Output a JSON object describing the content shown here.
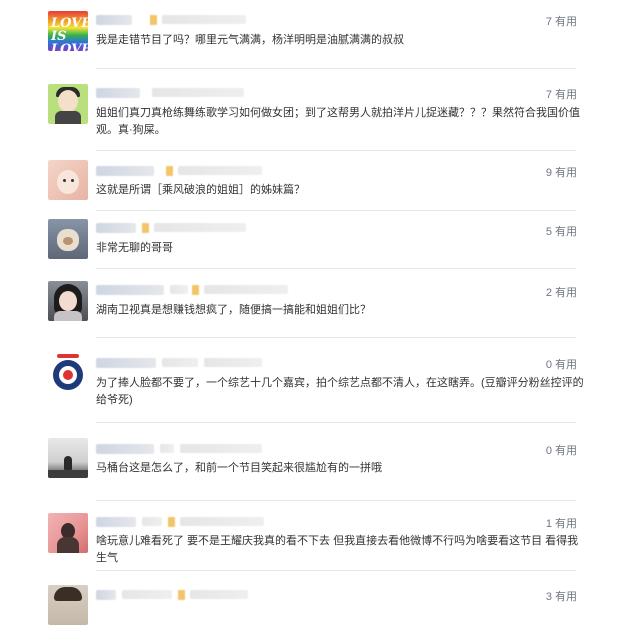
{
  "comments": [
    {
      "avatar": "rainbow-love-avatar",
      "avatar_text": "LOVE IS LOVE",
      "useful_count": "7",
      "useful_label": "有用",
      "text": "我是走错节目了吗？哪里元气满满，杨洋明明是油腻满满的叔叔"
    },
    {
      "avatar": "cartoon-girl-avatar",
      "useful_count": "7",
      "useful_label": "有用",
      "text": "姐姐们真刀真枪练舞练歌学习如何做女团；到了这帮男人就拍洋片儿捉迷藏？？？果然符合我国价值观。真·狗屎。"
    },
    {
      "avatar": "child-photo-avatar",
      "useful_count": "9",
      "useful_label": "有用",
      "text": "这就是所谓［乘风破浪的姐姐］的姊妹篇？"
    },
    {
      "avatar": "puppy-photo-avatar",
      "useful_count": "5",
      "useful_label": "有用",
      "text": "非常无聊的哥哥"
    },
    {
      "avatar": "girl-portrait-avatar",
      "useful_count": "2",
      "useful_label": "有用",
      "text": "湖南卫视真是想赚钱想疯了，随便搞一搞能和姐姐们比？"
    },
    {
      "avatar": "psg-logo-avatar",
      "useful_count": "0",
      "useful_label": "有用",
      "text": "为了捧人脸都不要了，一个综艺十几个嘉宾，拍个综艺点都不清人，在这瞎弄。(豆瓣评分粉丝控评的给爷死)"
    },
    {
      "avatar": "silhouette-photo-avatar",
      "useful_count": "0",
      "useful_label": "有用",
      "text": "马桶台这是怎么了，和前一个节目笑起来很尴尬有的一拼哦"
    },
    {
      "avatar": "pink-silhouette-avatar",
      "useful_count": "1",
      "useful_label": "有用",
      "text": "啥玩意儿难看死了 要不是王耀庆我真的看不下去 但我直接去看他微博不行吗为啥要看这节目 看得我生气"
    },
    {
      "avatar": "partial-photo-avatar",
      "useful_count": "3",
      "useful_label": "有用",
      "text": ""
    }
  ]
}
